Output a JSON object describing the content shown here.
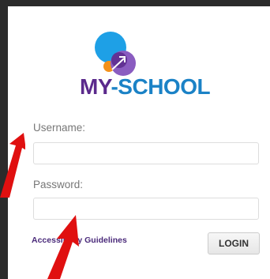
{
  "logo": {
    "text_my": "MY",
    "text_school": "-SCHOOL",
    "colors": {
      "blue": "#1ea0e6",
      "orange": "#f3921c",
      "purple": "#6b3fa0",
      "text_purple": "#5b2a8c",
      "text_blue": "#1b82c6"
    }
  },
  "form": {
    "username_label": "Username:",
    "username_value": "",
    "password_label": "Password:",
    "password_value": "",
    "accessibility_link": "Accessibility Guidelines",
    "login_label": "LOGIN"
  },
  "annotations": {
    "arrow_color": "#e01010"
  }
}
